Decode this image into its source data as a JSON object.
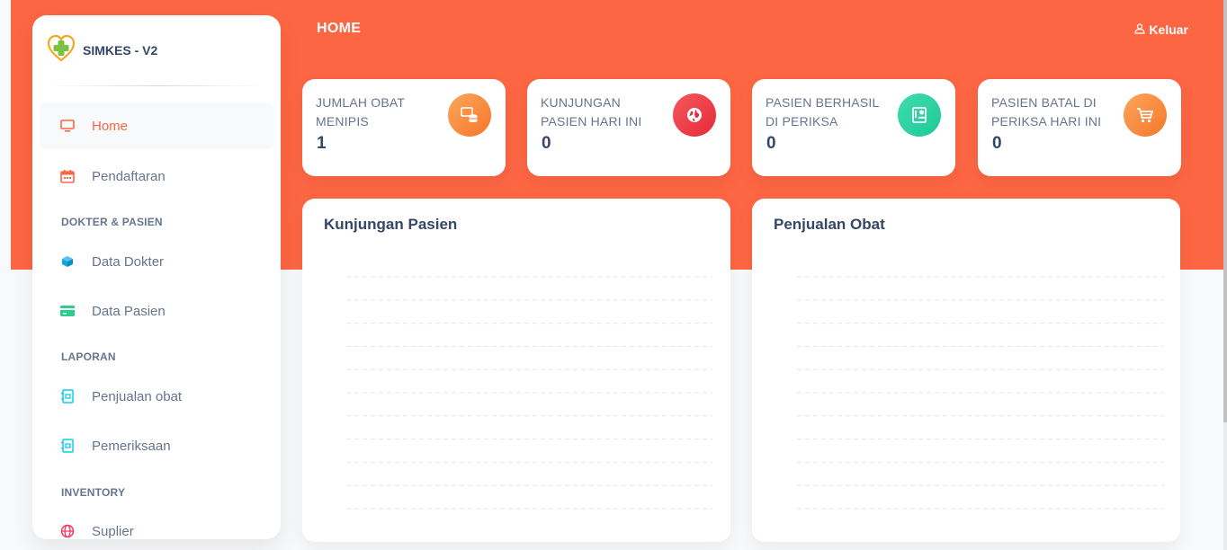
{
  "app": {
    "brand": "SIMKES - V2",
    "accent_color": "#fd6643"
  },
  "header": {
    "title": "HOME",
    "logout_label": "Keluar",
    "logout_icon": "user-icon"
  },
  "sidebar": {
    "items": [
      {
        "label": "Home",
        "icon": "monitor-icon",
        "active": true
      },
      {
        "label": "Pendaftaran",
        "icon": "calendar-icon"
      },
      {
        "section": "DOKTER & PASIEN"
      },
      {
        "label": "Data Dokter",
        "icon": "box-icon"
      },
      {
        "label": "Data Pasien",
        "icon": "card-icon"
      },
      {
        "section": "LAPORAN"
      },
      {
        "label": "Penjualan obat",
        "icon": "report-icon"
      },
      {
        "label": "Pemeriksaan",
        "icon": "report-icon"
      },
      {
        "section": "INVENTORY"
      },
      {
        "label": "Suplier",
        "icon": "globe-icon"
      }
    ]
  },
  "stats": [
    {
      "label": "JUMLAH OBAT MENIPIS",
      "value": "1",
      "icon": "database-icon",
      "color": "#f5772b"
    },
    {
      "label": "KUNJUNGAN PASIEN HARI INI",
      "value": "0",
      "icon": "world-icon",
      "color": "#e52b3c"
    },
    {
      "label": "PASIEN BERHASIL DI PERIKSA",
      "value": "0",
      "icon": "id-card-icon",
      "color": "#20c997"
    },
    {
      "label": "PASIEN BATAL DI PERIKSA HARI INI",
      "value": "0",
      "icon": "cart-icon",
      "color": "#f5772b"
    }
  ],
  "charts": [
    {
      "title": "Kunjungan Pasien"
    },
    {
      "title": "Penjualan Obat"
    }
  ],
  "chart_data": [
    {
      "type": "line",
      "title": "Kunjungan Pasien",
      "series": [],
      "ylim": [
        0,
        1
      ],
      "grid": true
    },
    {
      "type": "line",
      "title": "Penjualan Obat",
      "series": [],
      "ylim": [
        0,
        1
      ],
      "grid": true
    }
  ]
}
